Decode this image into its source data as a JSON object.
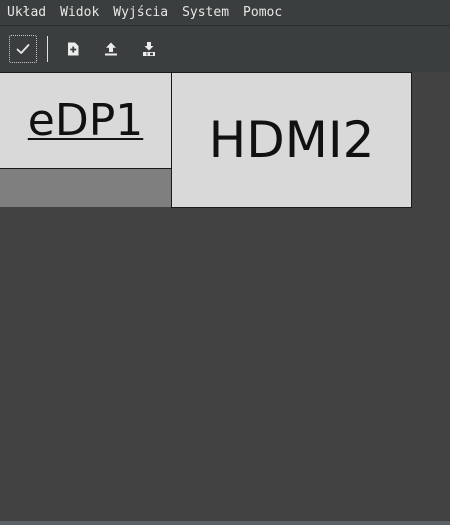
{
  "menu": {
    "items": [
      {
        "label": "Układ"
      },
      {
        "label": "Widok"
      },
      {
        "label": "Wyjścia"
      },
      {
        "label": "System"
      },
      {
        "label": "Pomoc"
      }
    ]
  },
  "toolbar": {
    "buttons": [
      {
        "icon": "check-icon"
      },
      {
        "icon": "new-document-icon"
      },
      {
        "icon": "upload-icon"
      },
      {
        "icon": "save-icon"
      }
    ]
  },
  "outputs": [
    {
      "name": "eDP1",
      "active": true
    },
    {
      "name": "HDMI2",
      "active": false
    }
  ],
  "colors": {
    "menubar_bg": "#3b3e3e",
    "canvas_bg": "#424242",
    "output_fill": "#d9d9d9",
    "screen_bg": "#7f7f7f"
  }
}
